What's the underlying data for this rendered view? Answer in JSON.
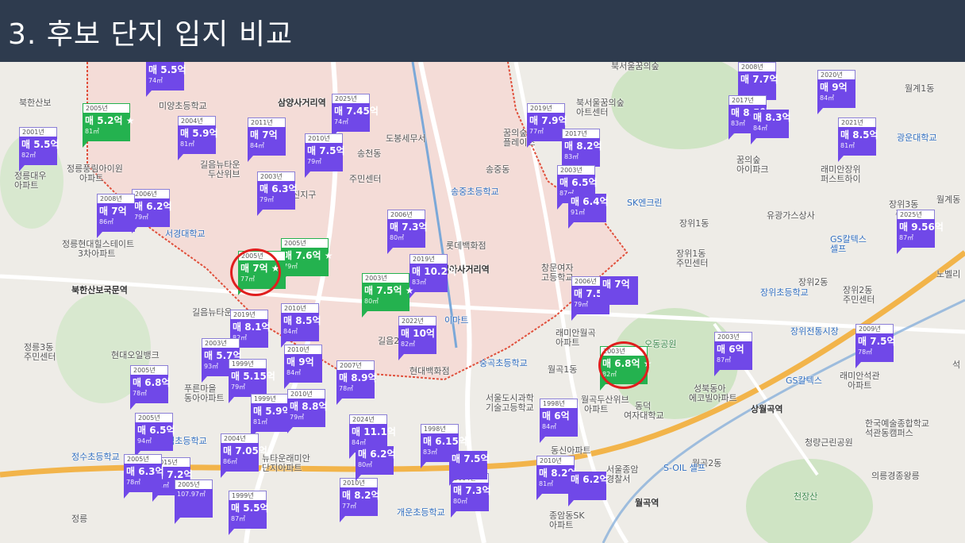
{
  "title": "3. 후보 단지 입지 비교",
  "colors": {
    "title_bar": "#2e3b4e",
    "marker_purple": "#7048e8",
    "marker_green": "#24b24f",
    "highlight_red": "#e01e1e",
    "subway_orange": "#f0a030"
  },
  "places": [
    {
      "name": "place-label",
      "text": "삼양사거리역",
      "cls": "dark"
    },
    {
      "name": "place-label",
      "text": "미양초등학교",
      "cls": ""
    },
    {
      "name": "place-label",
      "text": "정릉풍림아이원",
      "cls": ""
    },
    {
      "name": "place-label",
      "text": "아파트",
      "cls": ""
    },
    {
      "name": "place-label",
      "text": "정릉대우",
      "cls": ""
    },
    {
      "name": "place-label",
      "text": "아파트",
      "cls": ""
    },
    {
      "name": "place-label",
      "text": "서경대학교",
      "cls": "blue"
    },
    {
      "name": "place-label",
      "text": "정릉현대힐스테이트",
      "cls": ""
    },
    {
      "name": "place-label",
      "text": "3차아파트",
      "cls": ""
    },
    {
      "name": "place-label",
      "text": "북한산보국문역",
      "cls": "dark"
    },
    {
      "name": "place-label",
      "text": "길음뉴타운",
      "cls": ""
    },
    {
      "name": "place-label",
      "text": "정릉3동",
      "cls": ""
    },
    {
      "name": "place-label",
      "text": "주민센터",
      "cls": ""
    },
    {
      "name": "place-label",
      "text": "현대오일뱅크",
      "cls": ""
    },
    {
      "name": "place-label",
      "text": "푸른마을",
      "cls": ""
    },
    {
      "name": "place-label",
      "text": "동아아파트",
      "cls": ""
    },
    {
      "name": "place-label",
      "text": "숭덕초등학교",
      "cls": "blue"
    },
    {
      "name": "place-label",
      "text": "정수초등학교",
      "cls": "blue"
    },
    {
      "name": "place-label",
      "text": "뉴타운래미안",
      "cls": ""
    },
    {
      "name": "place-label",
      "text": "단지아파트",
      "cls": ""
    },
    {
      "name": "place-label",
      "text": "정릉",
      "cls": ""
    },
    {
      "name": "place-label",
      "text": "도봉세무서",
      "cls": ""
    },
    {
      "name": "place-label",
      "text": "송천동",
      "cls": ""
    },
    {
      "name": "place-label",
      "text": "주민센터",
      "cls": ""
    },
    {
      "name": "place-label",
      "text": "송중초등학교",
      "cls": "blue"
    },
    {
      "name": "place-label",
      "text": "롯데백화점",
      "cls": ""
    },
    {
      "name": "place-label",
      "text": "미아사거리역",
      "cls": "dark"
    },
    {
      "name": "place-label",
      "text": "이마트",
      "cls": "blue"
    },
    {
      "name": "place-label",
      "text": "길음2동",
      "cls": ""
    },
    {
      "name": "place-label",
      "text": "현대백화점",
      "cls": ""
    },
    {
      "name": "place-label",
      "text": "개운초등학교",
      "cls": "blue"
    },
    {
      "name": "place-label",
      "text": "송중동",
      "cls": ""
    },
    {
      "name": "place-label",
      "text": "꿈의숲해링턴",
      "cls": ""
    },
    {
      "name": "place-label",
      "text": "플레이스",
      "cls": ""
    },
    {
      "name": "place-label",
      "text": "북서울꿈의숲",
      "cls": ""
    },
    {
      "name": "place-label",
      "text": "아트센터",
      "cls": ""
    },
    {
      "name": "place-label",
      "text": "창문여자",
      "cls": ""
    },
    {
      "name": "place-label",
      "text": "고등학교",
      "cls": ""
    },
    {
      "name": "place-label",
      "text": "숭곡초등학교",
      "cls": "blue"
    },
    {
      "name": "place-label",
      "text": "서울도시과학",
      "cls": ""
    },
    {
      "name": "place-label",
      "text": "기술고등학교",
      "cls": ""
    },
    {
      "name": "place-label",
      "text": "월곡1동",
      "cls": ""
    },
    {
      "name": "place-label",
      "text": "래미안월곡",
      "cls": ""
    },
    {
      "name": "place-label",
      "text": "아파트",
      "cls": ""
    },
    {
      "name": "place-label",
      "text": "오동공원",
      "cls": "green"
    },
    {
      "name": "place-label",
      "text": "월곡두산위브",
      "cls": ""
    },
    {
      "name": "place-label",
      "text": "아파트",
      "cls": ""
    },
    {
      "name": "place-label",
      "text": "동덕",
      "cls": ""
    },
    {
      "name": "place-label",
      "text": "여자대학교",
      "cls": ""
    },
    {
      "name": "place-label",
      "text": "성북동아",
      "cls": ""
    },
    {
      "name": "place-label",
      "text": "에코빌아파트",
      "cls": ""
    },
    {
      "name": "place-label",
      "text": "상월곡역",
      "cls": "dark"
    },
    {
      "name": "place-label",
      "text": "월곡역",
      "cls": "dark"
    },
    {
      "name": "place-label",
      "text": "월곡2동",
      "cls": ""
    },
    {
      "name": "place-label",
      "text": "S-OIL 셀프",
      "cls": "blue"
    },
    {
      "name": "place-label",
      "text": "서울종암",
      "cls": ""
    },
    {
      "name": "place-label",
      "text": "경찰서",
      "cls": ""
    },
    {
      "name": "place-label",
      "text": "종암동SK",
      "cls": ""
    },
    {
      "name": "place-label",
      "text": "아파트",
      "cls": ""
    },
    {
      "name": "place-label",
      "text": "동신아파트",
      "cls": ""
    },
    {
      "name": "place-label",
      "text": "SK엔크린",
      "cls": "blue"
    },
    {
      "name": "place-label",
      "text": "장위1동",
      "cls": ""
    },
    {
      "name": "place-label",
      "text": "장위1동",
      "cls": ""
    },
    {
      "name": "place-label",
      "text": "주민센터",
      "cls": ""
    },
    {
      "name": "place-label",
      "text": "장위2동",
      "cls": ""
    },
    {
      "name": "place-label",
      "text": "장위초등학교",
      "cls": "blue"
    },
    {
      "name": "place-label",
      "text": "장위전통시장",
      "cls": "blue"
    },
    {
      "name": "place-label",
      "text": "장위2동",
      "cls": ""
    },
    {
      "name": "place-label",
      "text": "주민센터",
      "cls": ""
    },
    {
      "name": "place-label",
      "text": "유광가스상사",
      "cls": ""
    },
    {
      "name": "place-label",
      "text": "GS칼텍스",
      "cls": "blue"
    },
    {
      "name": "place-label",
      "text": "셀프",
      "cls": "blue"
    },
    {
      "name": "place-label",
      "text": "래미안석관",
      "cls": ""
    },
    {
      "name": "place-label",
      "text": "아파트",
      "cls": ""
    },
    {
      "name": "place-label",
      "text": "한국예술종합학교",
      "cls": ""
    },
    {
      "name": "place-label",
      "text": "석관동캠퍼스",
      "cls": ""
    },
    {
      "name": "place-label",
      "text": "청량근린공원",
      "cls": ""
    },
    {
      "name": "place-label",
      "text": "의릉경종왕릉",
      "cls": ""
    },
    {
      "name": "place-label",
      "text": "천장산",
      "cls": "green"
    },
    {
      "name": "place-label",
      "text": "월계1동",
      "cls": ""
    },
    {
      "name": "place-label",
      "text": "광운대학교",
      "cls": "blue"
    },
    {
      "name": "place-label",
      "text": "래미안장위",
      "cls": ""
    },
    {
      "name": "place-label",
      "text": "퍼스트하이",
      "cls": ""
    },
    {
      "name": "place-label",
      "text": "꿈의숲",
      "cls": ""
    },
    {
      "name": "place-label",
      "text": "아이파크",
      "cls": ""
    },
    {
      "name": "place-label",
      "text": "장위3동",
      "cls": ""
    },
    {
      "name": "place-label",
      "text": "주민센",
      "cls": ""
    },
    {
      "name": "place-label",
      "text": "월계동",
      "cls": ""
    },
    {
      "name": "place-label",
      "text": "노벨리",
      "cls": ""
    },
    {
      "name": "place-label",
      "text": "석",
      "cls": ""
    },
    {
      "name": "place-label",
      "text": "북서울꿈의숲",
      "cls": ""
    },
    {
      "name": "place-label",
      "text": "GS칼텍스",
      "cls": "blue"
    },
    {
      "name": "place-label",
      "text": "북한산보",
      "cls": ""
    },
    {
      "name": "place-label",
      "text": "길음뉴타운",
      "cls": ""
    },
    {
      "name": "place-label",
      "text": "두산위브",
      "cls": ""
    },
    {
      "name": "place-label",
      "text": "진지구",
      "cls": ""
    },
    {
      "name": "place-label",
      "text": "숭인초",
      "cls": ""
    }
  ],
  "markers": [
    {
      "year": "",
      "price": "매 5.5억",
      "area": "74㎡",
      "green": false
    },
    {
      "year": "2005년",
      "price": "매 5.2억 ★",
      "area": "81㎡",
      "green": true
    },
    {
      "year": "2001년",
      "price": "매 5.5억",
      "area": "82㎡",
      "green": false
    },
    {
      "year": "2004년",
      "price": "매 5.9억",
      "area": "81㎡",
      "green": false
    },
    {
      "year": "2011년",
      "price": "매 7억",
      "area": "84㎡",
      "green": false
    },
    {
      "year": "2025년",
      "price": "매 7.45억",
      "area": "74㎡",
      "green": false
    },
    {
      "year": "2010년",
      "price": "매 7.5억",
      "area": "79㎡",
      "green": false
    },
    {
      "year": "2003년",
      "price": "매 6.3억",
      "area": "79㎡",
      "green": false
    },
    {
      "year": "2006년",
      "price": "매 6.2억",
      "area": "79㎡",
      "green": false
    },
    {
      "year": "2008년",
      "price": "매 7억",
      "area": "86㎡",
      "green": false
    },
    {
      "year": "2005년",
      "price": "매 7.6억 ★",
      "area": "79㎡",
      "green": true
    },
    {
      "year": "2005년",
      "price": "매 7억 ★",
      "area": "77㎡",
      "green": true
    },
    {
      "year": "2006년",
      "price": "매 7.3억",
      "area": "80㎡",
      "green": false
    },
    {
      "year": "2019년",
      "price": "매 10.2억",
      "area": "83㎡",
      "green": false
    },
    {
      "year": "2003년",
      "price": "매 7.5억 ★",
      "area": "80㎡",
      "green": true
    },
    {
      "year": "2019년",
      "price": "매 8.1억",
      "area": "82㎡",
      "green": false
    },
    {
      "year": "2010년",
      "price": "매 8.5억",
      "area": "84㎡",
      "green": false
    },
    {
      "year": "2022년",
      "price": "매 10억",
      "area": "82㎡",
      "green": false
    },
    {
      "year": "2003년",
      "price": "매 5.7억",
      "area": "93㎡",
      "green": false
    },
    {
      "year": "2005년",
      "price": "매 6.8억",
      "area": "78㎡",
      "green": false
    },
    {
      "year": "1999년",
      "price": "매 5.15억",
      "area": "79㎡",
      "green": false
    },
    {
      "year": "2010년",
      "price": "매 9억",
      "area": "84㎡",
      "green": false
    },
    {
      "year": "2007년",
      "price": "매 8.9억",
      "area": "78㎡",
      "green": false
    },
    {
      "year": "1999년",
      "price": "매 5.9억",
      "area": "81㎡",
      "green": false
    },
    {
      "year": "2010년",
      "price": "매 8.8억",
      "area": "79㎡",
      "green": false
    },
    {
      "year": "2005년",
      "price": "매 6.5억",
      "area": "94㎡",
      "green": false
    },
    {
      "year": "2024년",
      "price": "매 11.1억",
      "area": "84㎡",
      "green": false
    },
    {
      "year": "1998년",
      "price": "매 6.15억",
      "area": "83㎡",
      "green": false
    },
    {
      "year": "2004년",
      "price": "매 7.05억",
      "area": "86㎡",
      "green": false
    },
    {
      "year": "2015년",
      "price": "매 7.2억",
      "area": "81㎡",
      "green": false
    },
    {
      "year": "2005년",
      "price": "매 6.3억",
      "area": "78㎡",
      "green": false
    },
    {
      "year": "2005년",
      "price": "",
      "area": "107.97㎡",
      "green": false
    },
    {
      "year": "1999년",
      "price": "매 5.5억",
      "area": "87㎡",
      "green": false
    },
    {
      "year": "2010년",
      "price": "매 8.2억",
      "area": "77㎡",
      "green": false
    },
    {
      "year": "",
      "price": "매 6.2억",
      "area": "80㎡",
      "green": false
    },
    {
      "year": "2004년",
      "price": "매 7.3억",
      "area": "80㎡",
      "green": false
    },
    {
      "year": "",
      "price": "매 7.5억",
      "area": "",
      "green": false
    },
    {
      "year": "2019년",
      "price": "매 7.9억",
      "area": "77㎡",
      "green": false
    },
    {
      "year": "2017년",
      "price": "매 8.2억",
      "area": "83㎡",
      "green": false
    },
    {
      "year": "2003년",
      "price": "매 6.5억",
      "area": "87㎡",
      "green": false
    },
    {
      "year": "",
      "price": "매 6.4억",
      "area": "91㎡",
      "green": false
    },
    {
      "year": "2006년",
      "price": "매 7.5억",
      "area": "79㎡",
      "green": false
    },
    {
      "year": "",
      "price": "매 7억",
      "area": "",
      "green": false
    },
    {
      "year": "2003년",
      "price": "매 6.8억 ★",
      "area": "82㎡",
      "green": true
    },
    {
      "year": "1998년",
      "price": "매 6억",
      "area": "84㎡",
      "green": false
    },
    {
      "year": "2010년",
      "price": "매 8.2억",
      "area": "81㎡",
      "green": false
    },
    {
      "year": "",
      "price": "매 6.2억",
      "area": "",
      "green": false
    },
    {
      "year": "2003년",
      "price": "매 6억",
      "area": "87㎡",
      "green": false
    },
    {
      "year": "2009년",
      "price": "매 7.5억",
      "area": "78㎡",
      "green": false
    },
    {
      "year": "2008년",
      "price": "매 7.7억",
      "area": "",
      "green": false
    },
    {
      "year": "2017년",
      "price": "매 8.5억",
      "area": "83㎡",
      "green": false
    },
    {
      "year": "",
      "price": "매 8.3억",
      "area": "84㎡",
      "green": false
    },
    {
      "year": "2020년",
      "price": "매 9억",
      "area": "84㎡",
      "green": false
    },
    {
      "year": "2021년",
      "price": "매 8.5억",
      "area": "81㎡",
      "green": false
    },
    {
      "year": "2025년",
      "price": "매 9.56억",
      "area": "87㎡",
      "green": false
    }
  ]
}
